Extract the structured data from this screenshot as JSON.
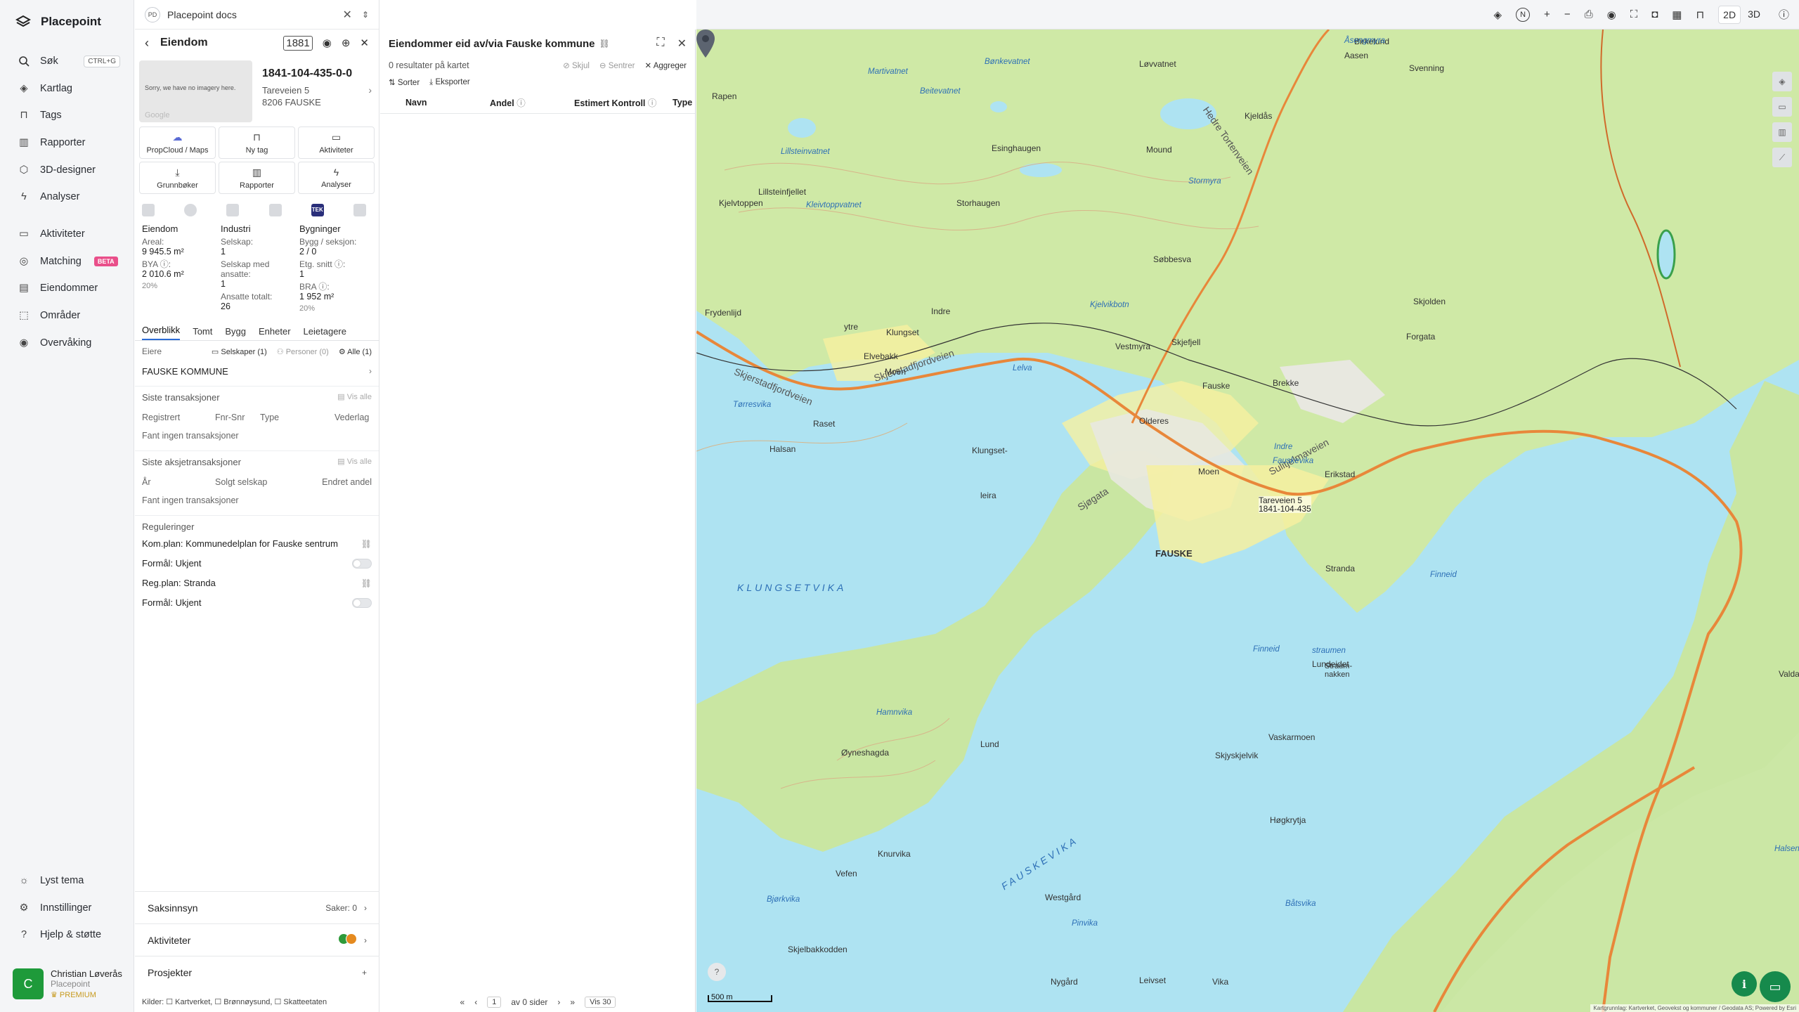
{
  "app": {
    "name": "Placepoint"
  },
  "sidebar": {
    "search": {
      "label": "Søk",
      "shortcut": "CTRL+G"
    },
    "items": [
      {
        "label": "Kartlag",
        "icon": "layers-icon"
      },
      {
        "label": "Tags",
        "icon": "bookmark-icon"
      },
      {
        "label": "Rapporter",
        "icon": "chart-icon"
      },
      {
        "label": "3D-designer",
        "icon": "cube-icon"
      },
      {
        "label": "Analyser",
        "icon": "bolt-icon"
      }
    ],
    "items2": [
      {
        "label": "Aktiviteter",
        "icon": "chat-icon"
      },
      {
        "label": "Matching",
        "icon": "target-icon",
        "badge": "BETA"
      },
      {
        "label": "Eiendommer",
        "icon": "building-icon"
      },
      {
        "label": "Områder",
        "icon": "area-icon"
      },
      {
        "label": "Overvåking",
        "icon": "eye-icon"
      }
    ],
    "bottom": [
      {
        "label": "Lyst tema",
        "icon": "sun-icon"
      },
      {
        "label": "Innstillinger",
        "icon": "gear-icon"
      },
      {
        "label": "Hjelp & støtte",
        "icon": "help-icon"
      }
    ],
    "user": {
      "initial": "C",
      "name": "Christian Løverås",
      "org": "Placepoint",
      "plan": "PREMIUM"
    }
  },
  "doc_tab": {
    "initials": "PD",
    "title": "Placepoint docs"
  },
  "property": {
    "header": "Eiendom",
    "id": "1841-104-435-0-0",
    "address1": "Tareveien 5",
    "address2": "8206 FAUSKE",
    "thumb_text": "Sorry, we have no imagery here.",
    "thumb_brand": "Google",
    "header_badge": "1881",
    "buttons": [
      "PropCloud / Maps",
      "Ny tag",
      "Aktiviteter",
      "Grunnbøker",
      "Rapporter",
      "Analyser"
    ],
    "source_tek": "TEK",
    "facts": {
      "col1_title": "Eiendom",
      "areal_label": "Areal:",
      "areal": "9 945.5 m²",
      "bya_label": "BYA ⓘ:",
      "bya": "2 010.6 m²",
      "bya_pct": "20%",
      "col2_title": "Industri",
      "selskap_label": "Selskap:",
      "selskap": "1",
      "ansatte_label": "Selskap med ansatte:",
      "ansatte": "1",
      "ansatte_tot_label": "Ansatte totalt:",
      "ansatte_tot": "26",
      "col3_title": "Bygninger",
      "bygg_label": "Bygg / seksjon:",
      "bygg": "2 / 0",
      "etg_label": "Etg. snitt ⓘ:",
      "etg": "1",
      "bra_label": "BRA ⓘ:",
      "bra": "1 952 m²",
      "bra_pct": "20%"
    },
    "tabs": [
      "Overblikk",
      "Tomt",
      "Bygg",
      "Enheter",
      "Leietagere"
    ],
    "owners_label": "Eiere",
    "owner_filters": [
      "Selskaper (1)",
      "Personer (0)",
      "Alle (1)"
    ],
    "owner": "FAUSKE KOMMUNE",
    "transactions": {
      "title": "Siste transaksjoner",
      "vis_alle": "Vis alle",
      "cols": [
        "Registrert",
        "Fnr-Snr",
        "Type",
        "Vederlag"
      ],
      "empty": "Fant ingen transaksjoner"
    },
    "share_tx": {
      "title": "Siste aksjetransaksjoner",
      "vis_alle": "Vis alle",
      "cols": [
        "År",
        "Solgt selskap",
        "Endret andel"
      ],
      "empty": "Fant ingen transaksjoner"
    },
    "reguleringer": {
      "title": "Reguleringer",
      "rows": [
        "Kom.plan: Kommunedelplan for Fauske sentrum",
        "Formål: Ukjent",
        "Reg.plan: Stranda",
        "Formål: Ukjent"
      ]
    },
    "sections": [
      {
        "label": "Saksinnsyn",
        "right": "Saker: 0"
      },
      {
        "label": "Aktiviteter"
      },
      {
        "label": "Prosjekter"
      }
    ],
    "kilder": "Kilder: ☐ Kartverket, ☐ Brønnøysund, ☐ Skatteetaten"
  },
  "panel2": {
    "title": "Eiendommer eid av/via Fauske kommune",
    "result": "0 resultater på kartet",
    "actions": [
      "Skjul",
      "Sentrer",
      "Aggreger"
    ],
    "tools": [
      "Sorter",
      "Eksporter"
    ],
    "columns": [
      "Navn",
      "Andel",
      "Estimert Kontroll",
      "Type"
    ],
    "pager": {
      "page": "1",
      "of": "av 0 sider",
      "show": "Vis 30"
    }
  },
  "map": {
    "mode_2d": "2D",
    "mode_3d": "3D",
    "north": "N",
    "scale": "500 m",
    "attribution": "Kartgrunnlag: Kartverket, Geovekst og kommuner / Geodata AS; Powered by Esri",
    "pin_label1": "Tareveien 5",
    "pin_label2": "1841-104-435",
    "labels": {
      "town": "FAUSKE",
      "klungsetvika": "KLUNGSETVIKA",
      "fauskevika": "FAUSKEVIKA",
      "skjerstad": "Skjerstadfjordveien",
      "sjoveien": "Sjøgata",
      "sulitjelma": "Sulitjelmaveien",
      "indre_tortenveien": "Hedre Tortenveien",
      "lelva": "Lelva",
      "jakobsbakken": "Storhaugen",
      "lillstein": "Lillsteinfjellet",
      "klungset": "Klungset",
      "moen": "Moen",
      "elvebakk": "Elvebakk",
      "ytre": "ytre",
      "indre": "Indre",
      "raset": "Raset",
      "halsan": "Halsan",
      "torresvika": "Tørresvika",
      "fryden": "Frydenlijd",
      "erikstad": "Erikstad",
      "stranda": "Stranda",
      "lundeidet": "Lundeidet",
      "lund": "Lund",
      "oynes": "Øyneshagda",
      "vefen": "Vefen",
      "knurvika": "Knurvika",
      "hamnvika": "Hamnvika",
      "bjorkvika": "Bjørkvika",
      "skjelbakk": "Skjelbakkodden",
      "vestmyra": "Vestmyra",
      "olderes": "Olderes",
      "lunde": "Moen",
      "valdalen": "Valdalen",
      "sobbesva": "Søbbesva",
      "finneid": "Finneid",
      "straumen": "straumen",
      "straumnakken": "Straum-\nnakken",
      "vaskarmoen": "Vaskarmoen",
      "skjoldet": "Skjyskjelvik",
      "hogkryta": "Høgkrytja",
      "halsen": "Halsen",
      "westgard": "Westgård",
      "batsvika": "Båtsvika",
      "nygard": "Nygård",
      "leivset": "Leivset",
      "vika": "Vika",
      "pinvika": "Pinvika",
      "rapen": "Rapen",
      "lovvatnet": "Løvvatnet",
      "klungsetfisk": "Klungset-",
      "leira": "leira",
      "storhaugen2": "Stormyra",
      "kjelvik": "Kjelvikbotn",
      "fauskevika2": "Fauskevika",
      "indre2": "Indre",
      "mound": "Mound",
      "esinghaugen": "Esinghaugen",
      "kjelvoppen": "Kjelvtoppen",
      "lhaugen": "Skjefjell",
      "bonkvatnet": "Bønkevatnet",
      "bj": "Birkelund",
      "aasen": "Aasen",
      "svenning": "Svenning",
      "kjelvik2": "Kjeldås",
      "skj": "Skjolden",
      "forgata": "Forgata",
      "brekke": "Brekke",
      "fauske2": "Fauske",
      "finneid2": "Finneid",
      "asengmyra": "Åsengmyra",
      "lillsteinvatnet": "Lillsteinvatnet",
      "kleivtoppvatnet": "Kleivtoppvatnet",
      "martivatnet": "Martivatnet",
      "beitevatnet": "Beitevatnet"
    }
  }
}
